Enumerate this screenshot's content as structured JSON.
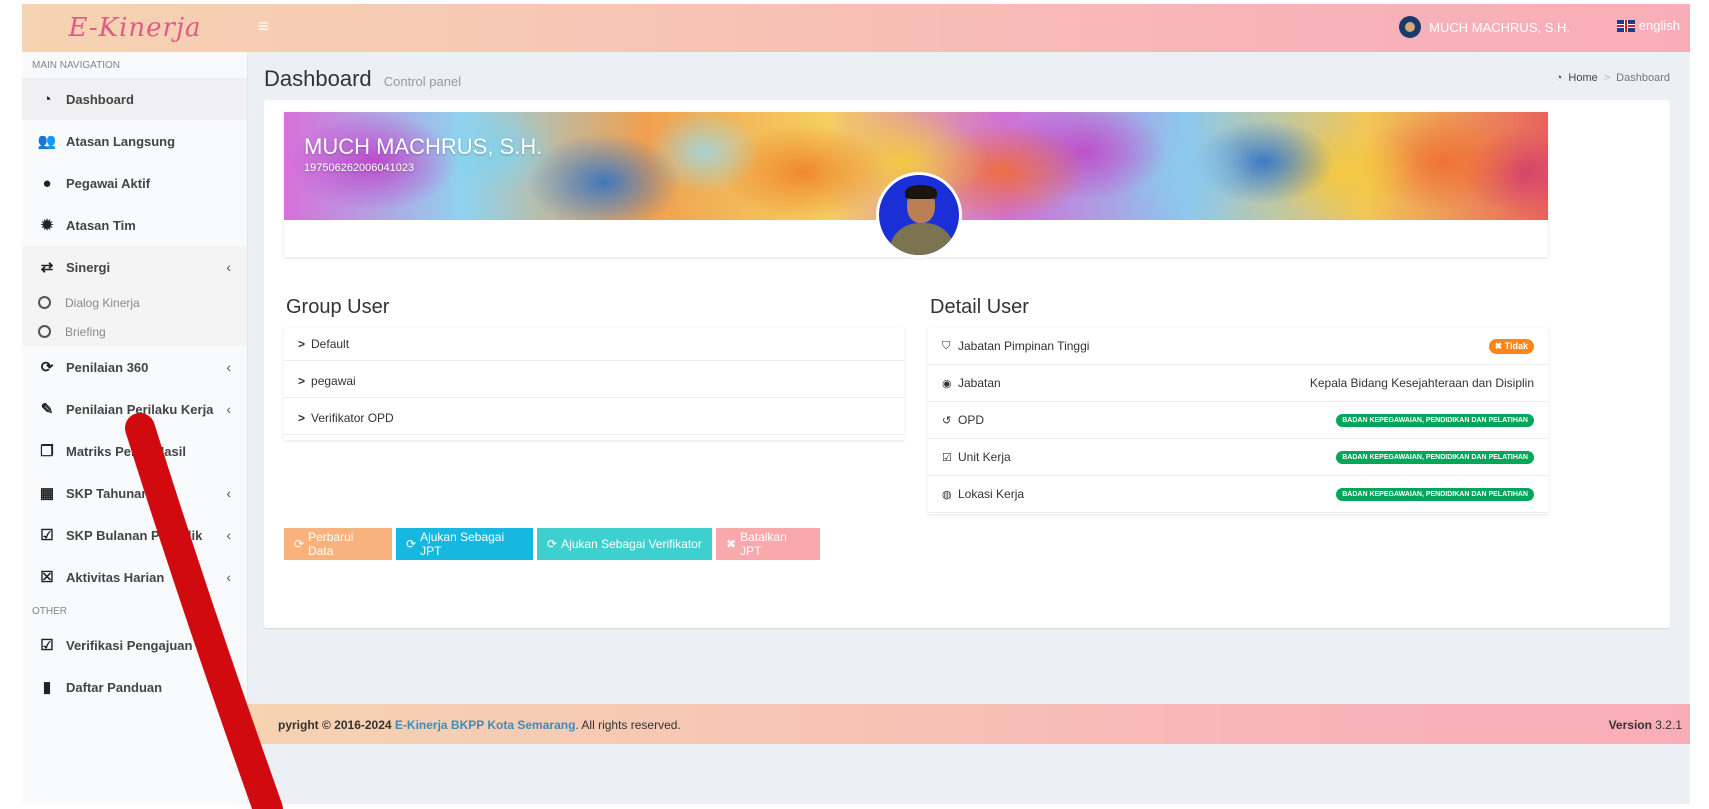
{
  "app": {
    "logo": "E-Kinerja"
  },
  "header": {
    "user_name": "MUCH MACHRUS, S.H.",
    "language": "english"
  },
  "sidebar": {
    "main_header": "MAIN NAVIGATION",
    "items": [
      {
        "label": "Dashboard",
        "icon": "dashboard-icon"
      },
      {
        "label": "Atasan Langsung",
        "icon": "users-icon"
      },
      {
        "label": "Pegawai Aktif",
        "icon": "user-icon"
      },
      {
        "label": "Atasan Tim",
        "icon": "gear-icon"
      },
      {
        "label": "Sinergi",
        "icon": "retweet-icon"
      },
      {
        "label": "Penilaian 360",
        "icon": "refresh-icon"
      },
      {
        "label": "Penilaian Perilaku Kerja",
        "icon": "edit-icon"
      },
      {
        "label": "Matriks Peran Hasil",
        "icon": "clone-icon"
      },
      {
        "label": "SKP Tahunan",
        "icon": "calendar-icon"
      },
      {
        "label": "SKP Bulanan Periodik",
        "icon": "calendar-check-icon"
      },
      {
        "label": "Aktivitas Harian",
        "icon": "calendar-times-icon"
      }
    ],
    "sinergi_sub": [
      "Dialog Kinerja",
      "Briefing"
    ],
    "other_header": "OTHER",
    "other_items": [
      {
        "label": "Verifikasi Pengajuan",
        "icon": "check-square-icon"
      },
      {
        "label": "Daftar Panduan",
        "icon": "book-icon"
      }
    ]
  },
  "content": {
    "title": "Dashboard",
    "subtitle": "Control panel",
    "breadcrumb": [
      "Home",
      "Dashboard"
    ]
  },
  "profile": {
    "name": "MUCH MACHRUS, S.H.",
    "nip": "197506262006041023"
  },
  "group_user": {
    "title": "Group User",
    "items": [
      "Default",
      "pegawai",
      "Verifikator OPD"
    ]
  },
  "detail_user": {
    "title": "Detail User",
    "rows": [
      {
        "label": "Jabatan Pimpinan Tinggi",
        "value": "Tidak",
        "type": "badge-orange"
      },
      {
        "label": "Jabatan",
        "value": "Kepala Bidang Kesejahteraan dan Disiplin",
        "type": "text"
      },
      {
        "label": "OPD",
        "value": "BADAN KEPEGAWAIAN, PENDIDIKAN DAN PELATIHAN",
        "type": "badge-green"
      },
      {
        "label": "Unit Kerja",
        "value": "BADAN KEPEGAWAIAN, PENDIDIKAN DAN PELATIHAN",
        "type": "badge-green"
      },
      {
        "label": "Lokasi Kerja",
        "value": "BADAN KEPEGAWAIAN, PENDIDIKAN DAN PELATIHAN",
        "type": "badge-green"
      }
    ]
  },
  "buttons": {
    "update": "Perbarui Data",
    "submit_jpt": "Ajukan Sebagai JPT",
    "submit_verifier": "Ajukan Sebagai Verifikator",
    "cancel_jpt": "Batalkan JPT"
  },
  "footer": {
    "copyright_prefix": "pyright © 2016-2024",
    "link": "E-Kinerja BKPP Kota Semarang",
    "suffix": ". All rights reserved.",
    "version_label": "Version",
    "version": "3.2.1"
  },
  "colors": {
    "header_start": "#f6d3b2",
    "header_end": "#f9adb8",
    "logo": "#e05a86",
    "badge_green": "#00a65a",
    "badge_orange": "#ff851b",
    "link": "#3c8dbc",
    "overlay_stroke": "#d10a10"
  }
}
